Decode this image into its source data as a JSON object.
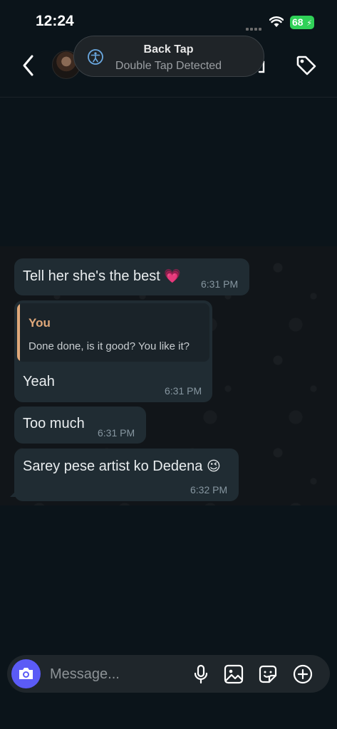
{
  "status_bar": {
    "time": "12:24",
    "battery": "68"
  },
  "toast": {
    "title": "Back Tap",
    "subtitle": "Double Tap Detected"
  },
  "messages": [
    {
      "text": "Tell her she's the best",
      "emoji": "💗",
      "time": "6:31 PM"
    },
    {
      "quote_author": "You",
      "quote_text": "Done done, is it good? You like it?",
      "text": "Yeah",
      "time": "6:31 PM"
    },
    {
      "text": "Too much",
      "time": "6:31 PM"
    },
    {
      "text": "Sarey pese artist ko Dedena",
      "emoji": "😉",
      "time": "6:32 PM"
    }
  ],
  "composer": {
    "placeholder": "Message..."
  },
  "colors": {
    "accent": "#5b5bf6",
    "quote_accent": "#e0a87a",
    "battery": "#30d158"
  }
}
